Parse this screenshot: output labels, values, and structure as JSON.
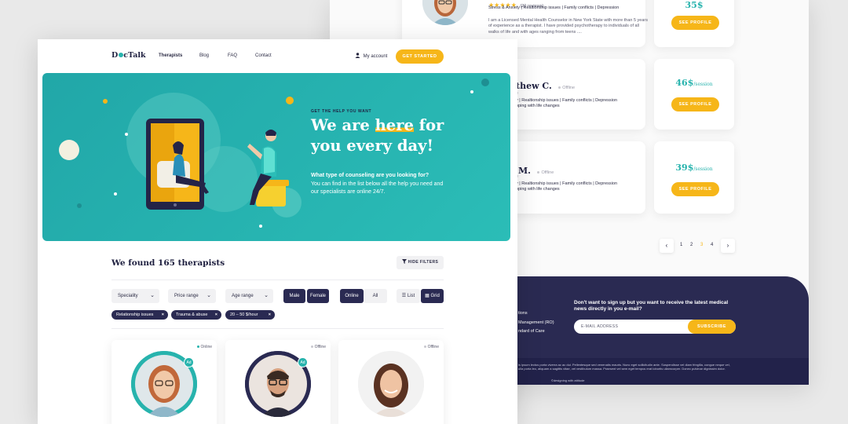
{
  "back": {
    "cards": [
      {
        "stars": "★★★★★",
        "reviews": "(20 reviews)",
        "tags": "Stress & Anxiety | Realtionship issues | Family conflicts | Depression",
        "bio": "I am a Licensed Mental Health Counselor in New York State with more than 5 years of experience as a therapist. I have provided psychotherapy to individuals of all walks of life and with ages ranging from teens ....",
        "price": "35$",
        "button": "SEE PROFILE"
      },
      {
        "name": "thew C.",
        "status": "Offline",
        "tag_line1": "y | Realtionship issues | Family conflicts | Depression",
        "tag_line2": "oping with life changes",
        "price": "46$",
        "unit": "/session",
        "button": "SEE PROFILE"
      },
      {
        "name": "M.",
        "status": "Offline",
        "tag_line1": "y | Realtionship issues | Family conflicts | Depression",
        "tag_line2": "oping with life changes",
        "price": "39$",
        "unit": "/session",
        "button": "SEE PROFILE"
      }
    ],
    "pagination": {
      "prev": "‹",
      "pages": [
        "1",
        "2",
        "3",
        "4"
      ],
      "active_page": "3",
      "next": "›"
    },
    "footer": {
      "links": [
        "tions",
        "Management (RO)",
        "ndard of Care"
      ],
      "newsletter_title": "Don't want to sign up but you want to receive the latest medical news directly in you e-mail?",
      "email_placeholder": "E-MAIL ADDRESS",
      "subscribe": "SUBSCRIBE",
      "legal": "is ipsum lectus porta viverra ac ac dui. Pellentesque sed venenatis mauris. Nunc eget sollicitudin ante. Suspendisse vel diam fringilla, congue neque vel, ulla porta leo, aliquam a sagittis vitae, vel vestibulum massa. Praesent vel sem eget tempus erat lobortis ullamcorper. Donec pulvinar dignissim dolor.",
      "credit": "©designing with attitude"
    }
  },
  "front": {
    "logo": {
      "left": "D",
      "right": "cTalk"
    },
    "nav": [
      "Therapists",
      "Blog",
      "FAQ",
      "Contact"
    ],
    "account": "My account",
    "get_started": "GET STARTED",
    "hero": {
      "eyebrow": "GET THE HELP YOU WANT",
      "headline_1": "We are ",
      "headline_highlight": "here",
      "headline_2": " for",
      "headline_3": "you every day!",
      "question": "What type of counseling are you looking for?",
      "body": "You can find in the list below all the help you need and our specialists are online 24/7."
    },
    "results_title": "We found 165 therapists",
    "hide_filters": "HIDE FILTERS",
    "filters": {
      "speciality": "Speciality",
      "price_range": "Price range",
      "age_range": "Age range",
      "male": "Male",
      "female": "Female",
      "online": "Online",
      "all": "All",
      "list": "List",
      "grid": "Grid"
    },
    "chips": [
      "Relationship issues",
      "Trauma & abuse",
      "20 – 50 $/hour"
    ],
    "therapists": [
      {
        "status": "Online",
        "status_color": "#27b3ad",
        "ad": "Ad"
      },
      {
        "status": "Offline",
        "status_color": "#c8c8cf",
        "ad": "Ad"
      },
      {
        "status": "Offline",
        "status_color": "#c8c8cf"
      }
    ]
  },
  "colors": {
    "teal": "#27b3ad",
    "navy": "#2a2a52",
    "yellow": "#f6b619"
  }
}
